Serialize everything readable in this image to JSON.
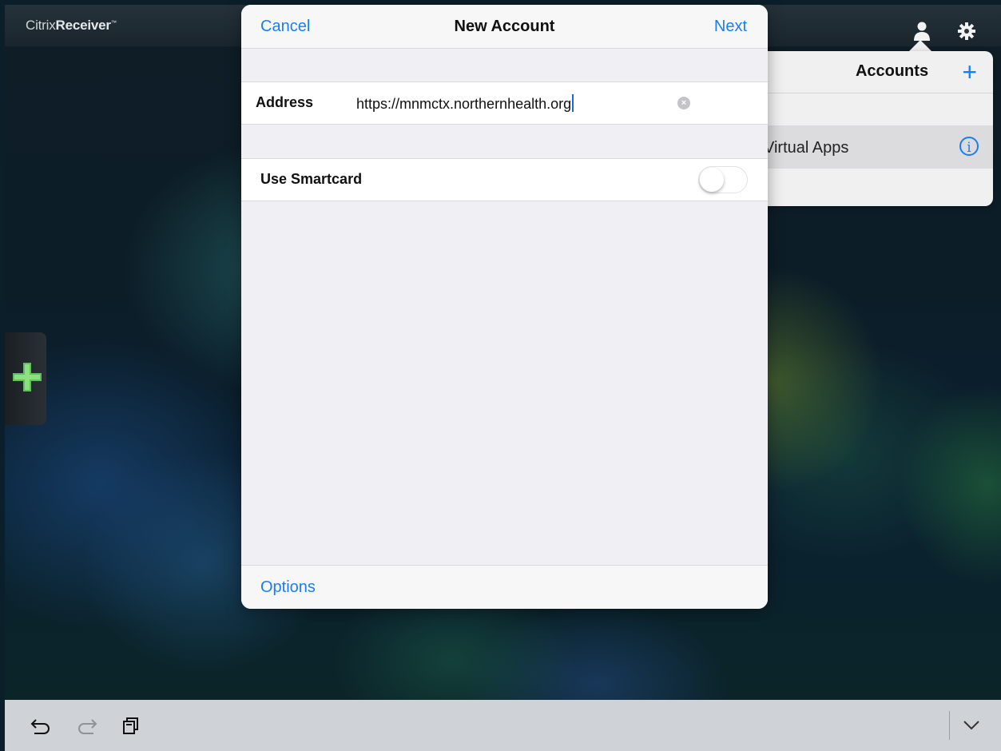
{
  "app": {
    "brand_light": "Citrix",
    "brand_bold": "Receiver",
    "brand_tm": "™"
  },
  "topbar": {
    "icons": [
      "user-icon",
      "gear-icon"
    ]
  },
  "accounts_popover": {
    "title": "Accounts",
    "add_label": "+",
    "rows": [
      {
        "label": "Virtual Apps",
        "icon": "info-icon"
      }
    ]
  },
  "modal": {
    "cancel_label": "Cancel",
    "title": "New Account",
    "next_label": "Next",
    "address_label": "Address",
    "address_value": "https://mnmctx.northernhealth.org",
    "smartcard_label": "Use Smartcard",
    "smartcard_on": false,
    "options_label": "Options"
  },
  "left_tab": {
    "icon": "plus-icon"
  },
  "bottombar": {
    "icons": [
      "undo-icon",
      "redo-icon",
      "paste-icon",
      "chevron-down-icon"
    ]
  },
  "colors": {
    "accent": "#1a7ef2",
    "modal_bg": "#efeff4",
    "bottom_bar": "#cfd3d8"
  }
}
